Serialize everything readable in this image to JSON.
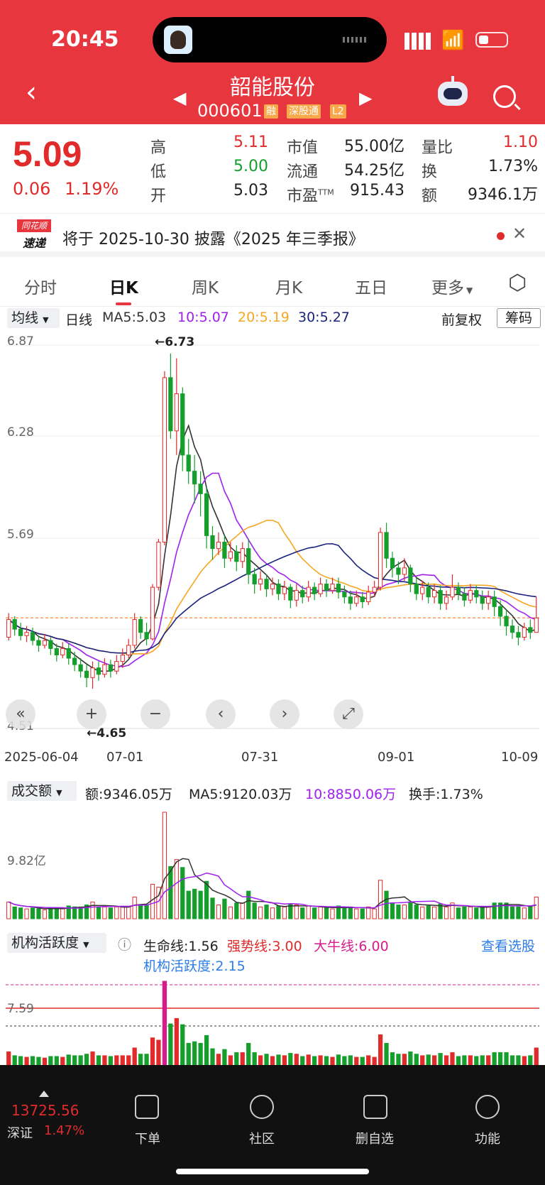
{
  "status": {
    "time": "20:45"
  },
  "header": {
    "title": "韶能股份",
    "code": "000601",
    "tags": [
      "融",
      "深股通",
      "L2"
    ],
    "icons": [
      "back-icon",
      "prev-arrow-icon",
      "next-arrow-icon",
      "robot-icon",
      "search-icon"
    ]
  },
  "quote": {
    "price": "5.09",
    "change": "0.06",
    "change_pct": "1.19%",
    "rows": [
      {
        "l1": "高",
        "v1": "5.11",
        "l2": "市值",
        "v2": "55.00亿",
        "l3": "量比",
        "v3": "1.10"
      },
      {
        "l1": "低",
        "v1": "5.00",
        "l2": "流通",
        "v2": "54.25亿",
        "l3": "换",
        "v3": "1.73%"
      },
      {
        "l1": "开",
        "v1": "5.03",
        "l2": "市盈",
        "l2sup": "TTM",
        "v2": "915.43",
        "l3": "额",
        "v3": "9346.1万"
      }
    ]
  },
  "notice": {
    "logo_top": "同花顺",
    "logo_bottom": "速递",
    "text": "将于 2025-10-30 披露《2025 年三季报》"
  },
  "tabs": [
    "分时",
    "日K",
    "周K",
    "月K",
    "五日",
    "更多"
  ],
  "active_tab": "日K",
  "indicators": {
    "dropdown": "均线",
    "period": "日线",
    "ma5": "MA5:5.03",
    "ma10": "10:5.07",
    "ma20": "20:5.19",
    "ma30": "30:5.27",
    "adjust": "前复权",
    "chip": "筹码"
  },
  "kline": {
    "y_labels": [
      "6.87",
      "6.28",
      "5.69",
      "4.51"
    ],
    "ylim": [
      4.51,
      6.87
    ],
    "high_marker": "←6.73",
    "low_marker": "←4.65",
    "x_labels": [
      "2025-06-04",
      "07-01",
      "07-31",
      "09-01",
      "10-09"
    ],
    "colors": {
      "up": "#e12a2a",
      "down": "#169e2d",
      "ma5": "#333333",
      "ma10": "#a020f0",
      "ma20": "#f5a623",
      "ma30": "#1a237e"
    }
  },
  "volume": {
    "dropdown": "成交额",
    "amount": "额:9346.05万",
    "ma5": "MA5:9120.03万",
    "ma10": "10:8850.06万",
    "turnover": "换手:1.73%",
    "y_label": "9.82亿"
  },
  "activity": {
    "dropdown": "机构活跃度",
    "life": "生命线:1.56",
    "strong": "强势线:3.00",
    "bull": "大牛线:6.00",
    "link": "查看选股",
    "value": "机构活跃度:2.15",
    "y_label": "7.59"
  },
  "bottom_bar": {
    "index_value": "13725.56",
    "index_name": "深证",
    "index_pct": "1.47%",
    "items": [
      "下单",
      "社区",
      "删自选",
      "功能"
    ]
  },
  "chart_data": {
    "type": "candlestick",
    "title": "",
    "x_labels": [
      "2025-06-04",
      "07-01",
      "07-31",
      "09-01",
      "10-09"
    ],
    "ylim": [
      4.51,
      6.87
    ],
    "annotations": [
      "←6.73",
      "←4.65"
    ],
    "candles": [
      [
        4.97,
        5.08,
        4.95,
        5.12
      ],
      [
        5.08,
        5.02,
        4.98,
        5.1
      ],
      [
        5.02,
        4.98,
        4.95,
        5.06
      ],
      [
        4.98,
        5.0,
        4.94,
        5.04
      ],
      [
        5.0,
        4.95,
        4.92,
        5.03
      ],
      [
        4.95,
        4.92,
        4.88,
        4.98
      ],
      [
        4.92,
        4.95,
        4.9,
        4.99
      ],
      [
        4.95,
        4.9,
        4.86,
        4.97
      ],
      [
        4.9,
        4.86,
        4.82,
        4.93
      ],
      [
        4.86,
        4.9,
        4.84,
        4.94
      ],
      [
        4.9,
        4.84,
        4.8,
        4.93
      ],
      [
        4.84,
        4.8,
        4.76,
        4.88
      ],
      [
        4.8,
        4.76,
        4.72,
        4.84
      ],
      [
        4.76,
        4.72,
        4.66,
        4.8
      ],
      [
        4.72,
        4.78,
        4.65,
        4.82
      ],
      [
        4.78,
        4.74,
        4.7,
        4.82
      ],
      [
        4.74,
        4.8,
        4.72,
        4.84
      ],
      [
        4.8,
        4.76,
        4.72,
        4.83
      ],
      [
        4.76,
        4.82,
        4.74,
        4.86
      ],
      [
        4.82,
        4.86,
        4.78,
        4.9
      ],
      [
        4.86,
        4.92,
        4.84,
        4.96
      ],
      [
        4.92,
        5.08,
        4.9,
        5.12
      ],
      [
        5.08,
        5.0,
        4.96,
        5.1
      ],
      [
        5.0,
        4.96,
        4.92,
        5.06
      ],
      [
        4.96,
        5.28,
        4.95,
        5.3
      ],
      [
        5.28,
        5.56,
        5.26,
        5.58
      ],
      [
        5.56,
        6.58,
        5.54,
        6.62
      ],
      [
        6.58,
        6.25,
        6.2,
        6.73
      ],
      [
        6.25,
        6.48,
        6.1,
        6.7
      ],
      [
        6.48,
        6.1,
        6.0,
        6.52
      ],
      [
        6.1,
        6.0,
        5.92,
        6.2
      ],
      [
        6.0,
        5.92,
        5.8,
        6.1
      ],
      [
        5.92,
        5.86,
        5.72,
        6.0
      ],
      [
        5.86,
        5.6,
        5.52,
        5.9
      ],
      [
        5.6,
        5.52,
        5.45,
        5.66
      ],
      [
        5.52,
        5.56,
        5.48,
        5.62
      ],
      [
        5.56,
        5.46,
        5.4,
        5.6
      ],
      [
        5.46,
        5.5,
        5.44,
        5.56
      ],
      [
        5.5,
        5.44,
        5.38,
        5.54
      ],
      [
        5.44,
        5.52,
        5.4,
        5.56
      ],
      [
        5.52,
        5.36,
        5.3,
        5.58
      ],
      [
        5.36,
        5.3,
        5.24,
        5.4
      ],
      [
        5.3,
        5.33,
        5.26,
        5.38
      ],
      [
        5.33,
        5.27,
        5.22,
        5.36
      ],
      [
        5.27,
        5.3,
        5.23,
        5.34
      ],
      [
        5.3,
        5.24,
        5.2,
        5.33
      ],
      [
        5.24,
        5.28,
        5.2,
        5.32
      ],
      [
        5.28,
        5.2,
        5.15,
        5.3
      ],
      [
        5.2,
        5.26,
        5.16,
        5.3
      ],
      [
        5.26,
        5.22,
        5.18,
        5.29
      ],
      [
        5.22,
        5.28,
        5.19,
        5.32
      ],
      [
        5.28,
        5.24,
        5.2,
        5.31
      ],
      [
        5.24,
        5.3,
        5.22,
        5.34
      ],
      [
        5.3,
        5.26,
        5.22,
        5.33
      ],
      [
        5.26,
        5.3,
        5.24,
        5.34
      ],
      [
        5.3,
        5.25,
        5.21,
        5.34
      ],
      [
        5.25,
        5.22,
        5.18,
        5.29
      ],
      [
        5.22,
        5.18,
        5.14,
        5.26
      ],
      [
        5.18,
        5.22,
        5.16,
        5.26
      ],
      [
        5.22,
        5.19,
        5.15,
        5.25
      ],
      [
        5.19,
        5.25,
        5.17,
        5.29
      ],
      [
        5.25,
        5.28,
        5.22,
        5.32
      ],
      [
        5.28,
        5.62,
        5.26,
        5.65
      ],
      [
        5.62,
        5.46,
        5.4,
        5.68
      ],
      [
        5.46,
        5.4,
        5.34,
        5.5
      ],
      [
        5.4,
        5.36,
        5.3,
        5.44
      ],
      [
        5.36,
        5.4,
        5.32,
        5.46
      ],
      [
        5.4,
        5.3,
        5.25,
        5.42
      ],
      [
        5.3,
        5.24,
        5.2,
        5.34
      ],
      [
        5.24,
        5.28,
        5.2,
        5.32
      ],
      [
        5.28,
        5.22,
        5.18,
        5.31
      ],
      [
        5.22,
        5.26,
        5.18,
        5.3
      ],
      [
        5.26,
        5.18,
        5.14,
        5.29
      ],
      [
        5.18,
        5.22,
        5.14,
        5.26
      ],
      [
        5.22,
        5.28,
        5.2,
        5.36
      ],
      [
        5.28,
        5.24,
        5.2,
        5.31
      ],
      [
        5.24,
        5.2,
        5.16,
        5.28
      ],
      [
        5.2,
        5.26,
        5.18,
        5.3
      ],
      [
        5.26,
        5.22,
        5.18,
        5.29
      ],
      [
        5.22,
        5.18,
        5.14,
        5.26
      ],
      [
        5.18,
        5.22,
        5.14,
        5.26
      ],
      [
        5.22,
        5.16,
        5.1,
        5.26
      ],
      [
        5.16,
        5.1,
        5.04,
        5.2
      ],
      [
        5.1,
        5.04,
        4.98,
        5.14
      ],
      [
        5.04,
        5.0,
        4.96,
        5.08
      ],
      [
        5.0,
        4.97,
        4.92,
        5.04
      ],
      [
        4.97,
        5.03,
        4.95,
        5.06
      ],
      [
        5.03,
        5.0,
        4.96,
        5.08
      ],
      [
        5.0,
        5.09,
        5.0,
        5.22
      ]
    ]
  }
}
